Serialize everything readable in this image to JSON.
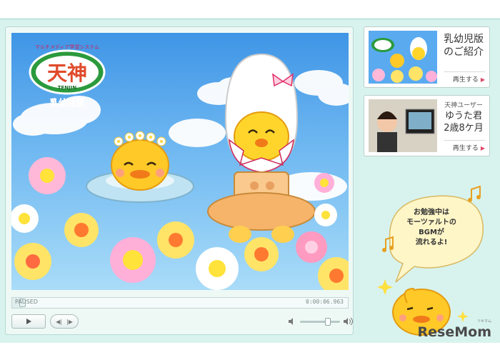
{
  "player": {
    "logo_tagline": "マルチメディア学習システム",
    "logo_title": "天神",
    "logo_romaji": "TENJIN",
    "logo_edition": "乳幼児版",
    "status": "PAUSED",
    "time": "0:00:06.963",
    "progress": 0.03,
    "volume": 0.7
  },
  "cards": [
    {
      "title_lines": [
        "乳幼児版",
        "のご紹介"
      ],
      "play_label": "再生する"
    },
    {
      "small": "天神ユーザー",
      "lines": [
        "ゆうた君",
        "2歳8ケ月"
      ],
      "play_label": "再生する"
    }
  ],
  "bubble": {
    "lines": [
      "お勉強中は",
      "モーツァルトの",
      "BGMが",
      "流れるよ!"
    ]
  },
  "watermark": {
    "brand": "ReseMom",
    "brand_sub": "リセマム"
  },
  "icons": [
    "play-icon",
    "prev-icon",
    "next-icon",
    "volume-low-icon",
    "volume-high-icon",
    "music-note-icon",
    "sparkle-icon"
  ],
  "colors": {
    "background": "#d8f3ee",
    "accent": "#e04a6a",
    "sky": "#3f95e6"
  }
}
